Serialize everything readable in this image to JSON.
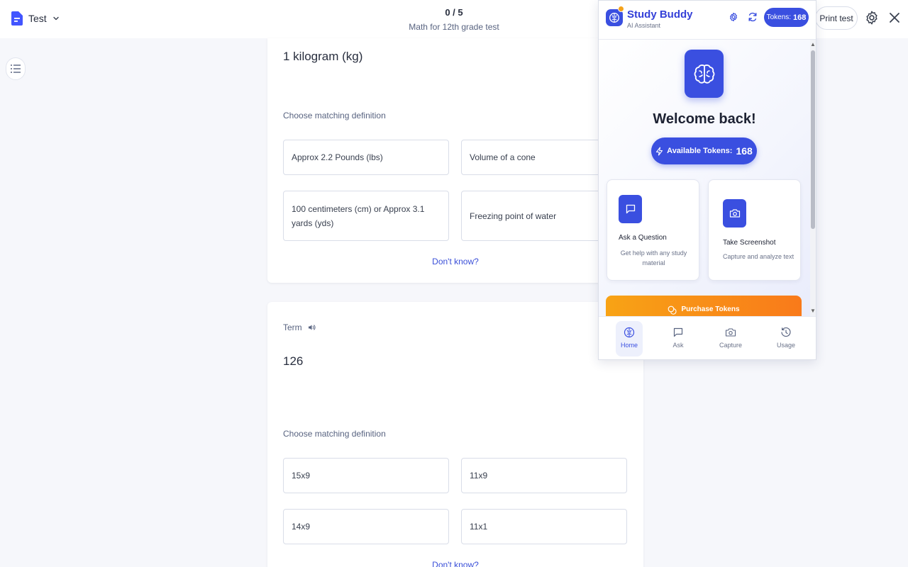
{
  "topbar": {
    "mode_label": "Test",
    "progress": "0 / 5",
    "test_title": "Math for 12th grade test",
    "print_label": "Print test"
  },
  "questions": [
    {
      "term": "1 kilogram (kg)",
      "prompt": "Choose matching definition",
      "options": [
        "Approx 2.2 Pounds (lbs)",
        "Volume of a cone",
        "100 centimeters (cm) or Approx 3.1 yards (yds)",
        "Freezing point of water"
      ],
      "dont_know": "Don't know?"
    },
    {
      "term_label": "Term",
      "term": "126",
      "prompt": "Choose matching definition",
      "options": [
        "15x9",
        "11x9",
        "14x9",
        "11x1"
      ],
      "dont_know": "Don't know?"
    }
  ],
  "panel": {
    "title": "Study Buddy",
    "subtitle": "AI Assistant",
    "tokens_label": "Tokens:",
    "tokens_value": "168",
    "welcome": "Welcome back!",
    "available_label": "Available Tokens:",
    "available_value": "168",
    "features": [
      {
        "title": "Ask a Question",
        "desc": "Get help with any study material"
      },
      {
        "title": "Take Screenshot",
        "desc": "Capture and analyze text"
      }
    ],
    "purchase_label": "Purchase Tokens",
    "nav": [
      {
        "label": "Home"
      },
      {
        "label": "Ask"
      },
      {
        "label": "Capture"
      },
      {
        "label": "Usage"
      }
    ],
    "accent": "#3a4fe0",
    "orange": "#f97a1a"
  }
}
